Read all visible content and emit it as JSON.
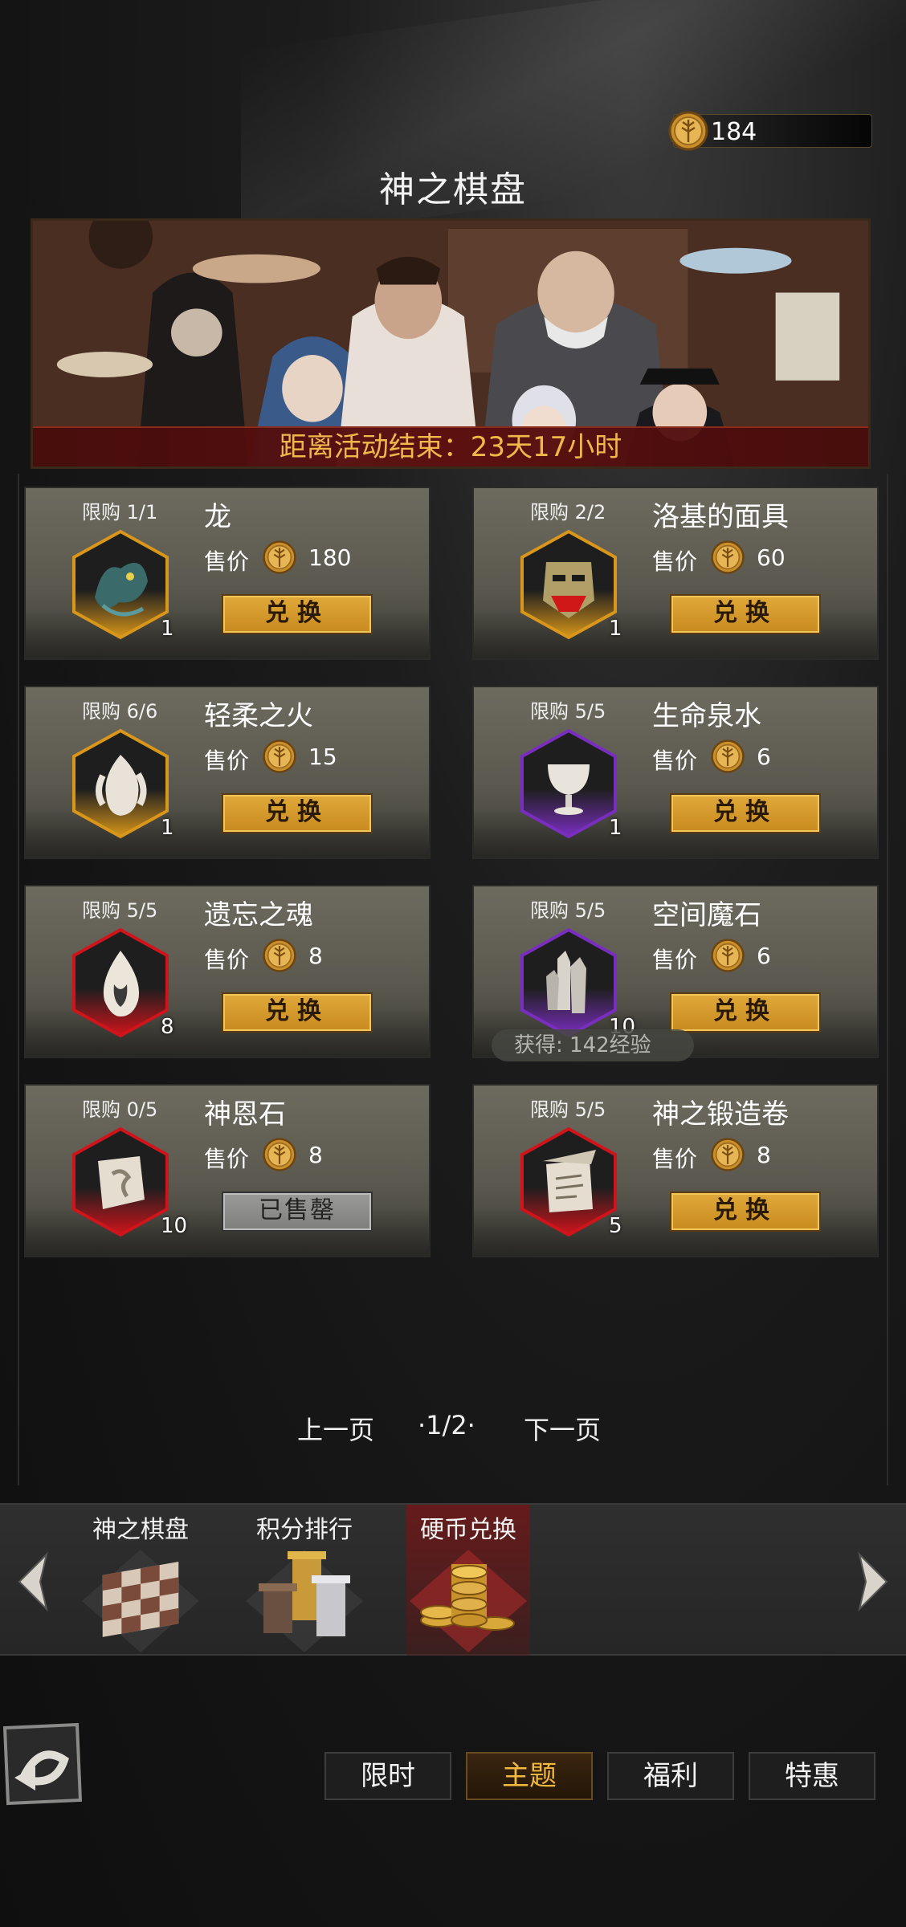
{
  "currency": {
    "amount": "184",
    "icon": "gold-coin-icon"
  },
  "page_title": "神之棋盘",
  "banner": {
    "timer_text": "距离活动结束：23天17小时"
  },
  "items": [
    {
      "limit": "限购 1/1",
      "name": "龙",
      "price_label": "售价",
      "price": "180",
      "qty": "1",
      "button": "兑换",
      "icon": "dragon-icon",
      "rarity": "gold",
      "sold_out": false
    },
    {
      "limit": "限购 2/2",
      "name": "洛基的面具",
      "price_label": "售价",
      "price": "60",
      "qty": "1",
      "button": "兑换",
      "icon": "mask-icon",
      "rarity": "gold",
      "sold_out": false
    },
    {
      "limit": "限购 6/6",
      "name": "轻柔之火",
      "price_label": "售价",
      "price": "15",
      "qty": "1",
      "button": "兑换",
      "icon": "white-flame-icon",
      "rarity": "gold",
      "sold_out": false
    },
    {
      "limit": "限购 5/5",
      "name": "生命泉水",
      "price_label": "售价",
      "price": "6",
      "qty": "1",
      "button": "兑换",
      "icon": "chalice-icon",
      "rarity": "purple",
      "sold_out": false
    },
    {
      "limit": "限购 5/5",
      "name": "遗忘之魂",
      "price_label": "售价",
      "price": "8",
      "qty": "8",
      "button": "兑换",
      "icon": "soul-flame-icon",
      "rarity": "red",
      "sold_out": false
    },
    {
      "limit": "限购 5/5",
      "name": "空间魔石",
      "price_label": "售价",
      "price": "6",
      "qty": "10",
      "button": "兑换",
      "icon": "crystal-icon",
      "rarity": "purple",
      "sold_out": false
    },
    {
      "limit": "限购 0/5",
      "name": "神恩石",
      "price_label": "售价",
      "price": "8",
      "qty": "10",
      "button": "已售罄",
      "icon": "rune-stone-icon",
      "rarity": "red",
      "sold_out": true
    },
    {
      "limit": "限购 5/5",
      "name": "神之锻造卷",
      "price_label": "售价",
      "price": "8",
      "qty": "5",
      "button": "兑换",
      "icon": "scroll-icon",
      "rarity": "red",
      "sold_out": false
    }
  ],
  "exp_tip": "获得: 142经验",
  "pagination": {
    "prev": "上一页",
    "current": "·1/2·",
    "next": "下一页"
  },
  "tabs": [
    {
      "label": "神之棋盘",
      "icon": "chessboard-icon",
      "active": false
    },
    {
      "label": "积分排行",
      "icon": "pillars-icon",
      "active": false
    },
    {
      "label": "硬币兑换",
      "icon": "coin-pile-icon",
      "active": true
    }
  ],
  "nav": [
    {
      "label": "限时",
      "active": false
    },
    {
      "label": "主题",
      "active": true
    },
    {
      "label": "福利",
      "active": false
    },
    {
      "label": "特惠",
      "active": false
    }
  ],
  "colors": {
    "gold": "#e0a93a",
    "purple": "#7a3ab8",
    "red": "#c8141e",
    "accent_text": "#f3b93e"
  }
}
